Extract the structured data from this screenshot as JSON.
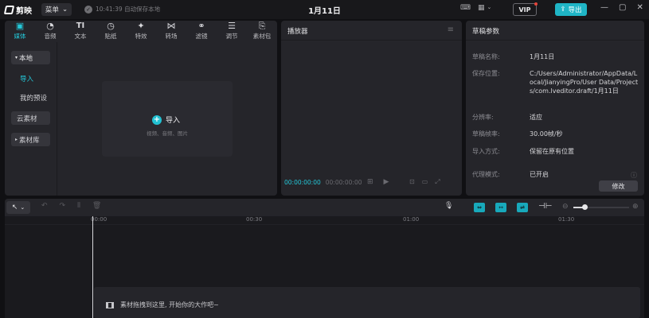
{
  "titlebar": {
    "app_name": "剪映",
    "menu_label": "菜单",
    "save_status": "10:41:39 自动保存本地",
    "project_title": "1月11日",
    "vip_label": "VIP",
    "export_label": "导出",
    "accent_color": "#1fb5c6"
  },
  "media": {
    "tabs": [
      {
        "label": "媒体",
        "icon": "media-icon"
      },
      {
        "label": "音频",
        "icon": "audio-icon"
      },
      {
        "label": "文本",
        "icon": "text-icon"
      },
      {
        "label": "贴纸",
        "icon": "sticker-icon"
      },
      {
        "label": "特效",
        "icon": "effects-icon"
      },
      {
        "label": "转场",
        "icon": "transition-icon"
      },
      {
        "label": "滤镜",
        "icon": "filter-icon"
      },
      {
        "label": "调节",
        "icon": "adjust-icon"
      },
      {
        "label": "素材包",
        "icon": "pack-icon"
      }
    ],
    "sidebar": {
      "local": "本地",
      "import": "导入",
      "presets": "我的预设",
      "cloud": "云素材",
      "library": "素材库"
    },
    "import_card": {
      "label": "导入",
      "hint": "视频、音频、图片"
    }
  },
  "player": {
    "title": "播放器",
    "timecode_current": "00:00:00:00",
    "timecode_duration": "00:00:00:00"
  },
  "draft": {
    "title": "草稿参数",
    "rows": [
      {
        "key": "草稿名称:",
        "value": "1月11日"
      },
      {
        "key": "保存位置:",
        "value": "C:/Users/Administrator/AppData/Local/JianyingPro/User Data/Projects/com.lveditor.draft/1月11日"
      },
      {
        "key": "分辨率:",
        "value": "适应"
      },
      {
        "key": "草稿帧率:",
        "value": "30.00帧/秒"
      },
      {
        "key": "导入方式:",
        "value": "保留在原有位置"
      },
      {
        "key": "代理模式:",
        "value": "已开启"
      }
    ],
    "edit_label": "修改"
  },
  "timeline": {
    "ruler_labels": [
      "00:00",
      "00:30",
      "01:00",
      "01:30"
    ],
    "track_hint": "素材拖拽到这里, 开始你的大作吧~",
    "zoom_level": 0.2
  }
}
